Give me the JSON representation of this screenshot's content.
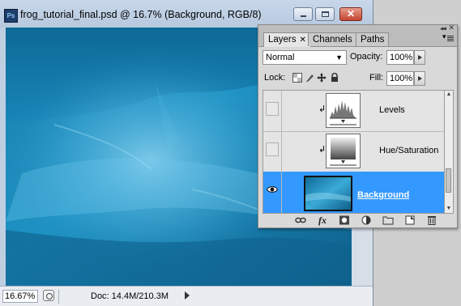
{
  "document": {
    "title": "frog_tutorial_final.psd @ 16.7% (Background, RGB/8)",
    "app_icon_label": "Ps",
    "zoom": "16.67%",
    "doc_info": "Doc: 14.4M/210.3M"
  },
  "window_controls": {
    "minimize": "minimize",
    "maximize": "maximize",
    "close": "✕"
  },
  "layers_panel": {
    "tabs": [
      {
        "label": "Layers",
        "active": true,
        "has_close": true
      },
      {
        "label": "Channels",
        "active": false
      },
      {
        "label": "Paths",
        "active": false
      }
    ],
    "blend_mode": "Normal",
    "opacity_label": "Opacity:",
    "opacity_value": "100%",
    "lock_label": "Lock:",
    "fill_label": "Fill:",
    "fill_value": "100%",
    "layers": [
      {
        "name": "Levels",
        "kind": "adjustment-levels",
        "visible": false,
        "clipped": true,
        "selected": false
      },
      {
        "name": "Hue/Saturation",
        "kind": "adjustment-hue-saturation",
        "visible": false,
        "clipped": true,
        "selected": false
      },
      {
        "name": "Background",
        "kind": "image",
        "visible": true,
        "clipped": false,
        "selected": true
      }
    ],
    "bottom_icons": [
      "link-layers-icon",
      "fx-icon",
      "add-mask-icon",
      "adjustment-layer-icon",
      "new-group-icon",
      "new-layer-icon",
      "trash-icon"
    ],
    "fx_label": "fx"
  },
  "colors": {
    "selection": "#3399ff",
    "water": "#1779a6",
    "panel": "#d9d9d9",
    "titlebar": "#bfcfe2"
  }
}
